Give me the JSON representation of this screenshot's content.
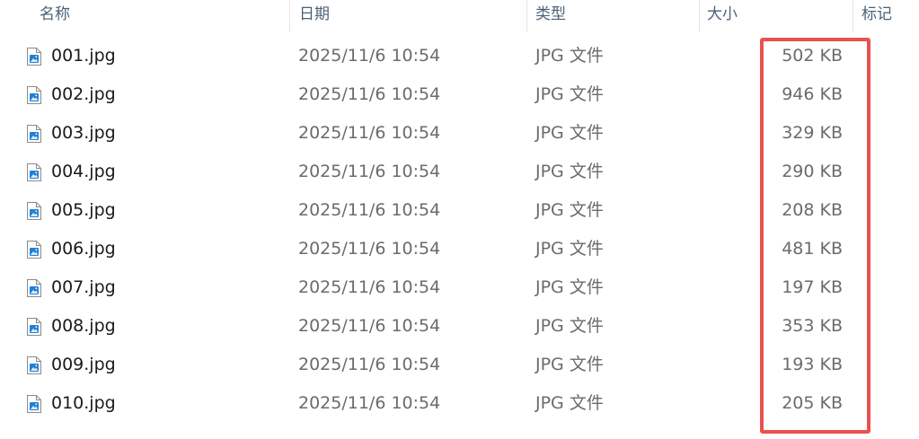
{
  "columns": {
    "name": "名称",
    "date": "日期",
    "type": "类型",
    "size": "大小",
    "tags": "标记"
  },
  "sort_indicator": "^",
  "files": [
    {
      "name": "001.jpg",
      "date": "2025/11/6 10:54",
      "type": "JPG 文件",
      "size": "502 KB"
    },
    {
      "name": "002.jpg",
      "date": "2025/11/6 10:54",
      "type": "JPG 文件",
      "size": "946 KB"
    },
    {
      "name": "003.jpg",
      "date": "2025/11/6 10:54",
      "type": "JPG 文件",
      "size": "329 KB"
    },
    {
      "name": "004.jpg",
      "date": "2025/11/6 10:54",
      "type": "JPG 文件",
      "size": "290 KB"
    },
    {
      "name": "005.jpg",
      "date": "2025/11/6 10:54",
      "type": "JPG 文件",
      "size": "208 KB"
    },
    {
      "name": "006.jpg",
      "date": "2025/11/6 10:54",
      "type": "JPG 文件",
      "size": "481 KB"
    },
    {
      "name": "007.jpg",
      "date": "2025/11/6 10:54",
      "type": "JPG 文件",
      "size": "197 KB"
    },
    {
      "name": "008.jpg",
      "date": "2025/11/6 10:54",
      "type": "JPG 文件",
      "size": "353 KB"
    },
    {
      "name": "009.jpg",
      "date": "2025/11/6 10:54",
      "type": "JPG 文件",
      "size": "193 KB"
    },
    {
      "name": "010.jpg",
      "date": "2025/11/6 10:54",
      "type": "JPG 文件",
      "size": "205 KB"
    }
  ],
  "icons": {
    "file": "jpg-file-icon"
  },
  "colors": {
    "highlight": "#e8524f",
    "icon_blue": "#1f7fd6",
    "header_text": "#4c607a",
    "secondary_text": "#6b6b6b"
  }
}
